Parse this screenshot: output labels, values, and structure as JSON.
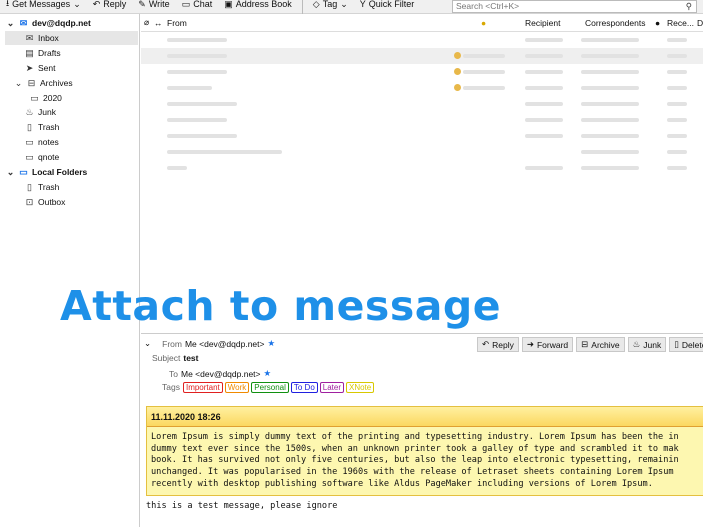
{
  "toolbar": {
    "get_messages": "Get Messages",
    "reply": "Reply",
    "write": "Write",
    "chat": "Chat",
    "address_book": "Address Book",
    "tag": "Tag",
    "quick_filter": "Quick Filter",
    "search_placeholder": "Search <Ctrl+K>"
  },
  "sidebar": {
    "account": "dev@dqdp.net",
    "items": [
      {
        "label": "Inbox"
      },
      {
        "label": "Drafts"
      },
      {
        "label": "Sent"
      },
      {
        "label": "Archives"
      },
      {
        "label": "2020"
      },
      {
        "label": "Junk"
      },
      {
        "label": "Trash"
      },
      {
        "label": "notes"
      },
      {
        "label": "qnote"
      }
    ],
    "local_folders": "Local Folders",
    "local_items": [
      {
        "label": "Trash"
      },
      {
        "label": "Outbox"
      }
    ]
  },
  "list": {
    "columns": {
      "from": "From",
      "recipient": "Recipient",
      "correspondents": "Correspondents",
      "received": "Rece...",
      "d": "D"
    }
  },
  "overlay": "Attach to message",
  "message": {
    "from_label": "From",
    "from": "Me <dev@dqdp.net>",
    "subject_label": "Subject",
    "subject": "test",
    "to_label": "To",
    "to": "Me <dev@dqdp.net>",
    "tags_label": "Tags",
    "tags": [
      {
        "label": "Important",
        "color": "#e02020"
      },
      {
        "label": "Work",
        "color": "#f08a00"
      },
      {
        "label": "Personal",
        "color": "#109010"
      },
      {
        "label": "To Do",
        "color": "#2020e0"
      },
      {
        "label": "Later",
        "color": "#a020a0"
      },
      {
        "label": "XNote",
        "color": "#d8c800"
      }
    ],
    "buttons": {
      "reply": "Reply",
      "forward": "Forward",
      "archive": "Archive",
      "junk": "Junk",
      "delete": "Delete"
    },
    "note_date": "11.11.2020 18:26",
    "note_lines": [
      "Lorem Ipsum is simply dummy text of the printing and typesetting industry. Lorem Ipsum has been the in",
      "dummy text ever since the 1500s, when an unknown printer took a galley of type and scrambled it to mak",
      "book. It has survived not only five centuries, but also the leap into electronic typesetting, remainin",
      "unchanged. It was popularised in the 1960s with the release of Letraset sheets containing Lorem Ipsum",
      "recently with desktop publishing software like Aldus PageMaker including versions of Lorem Ipsum."
    ],
    "body": "this is a test message, please ignore"
  }
}
